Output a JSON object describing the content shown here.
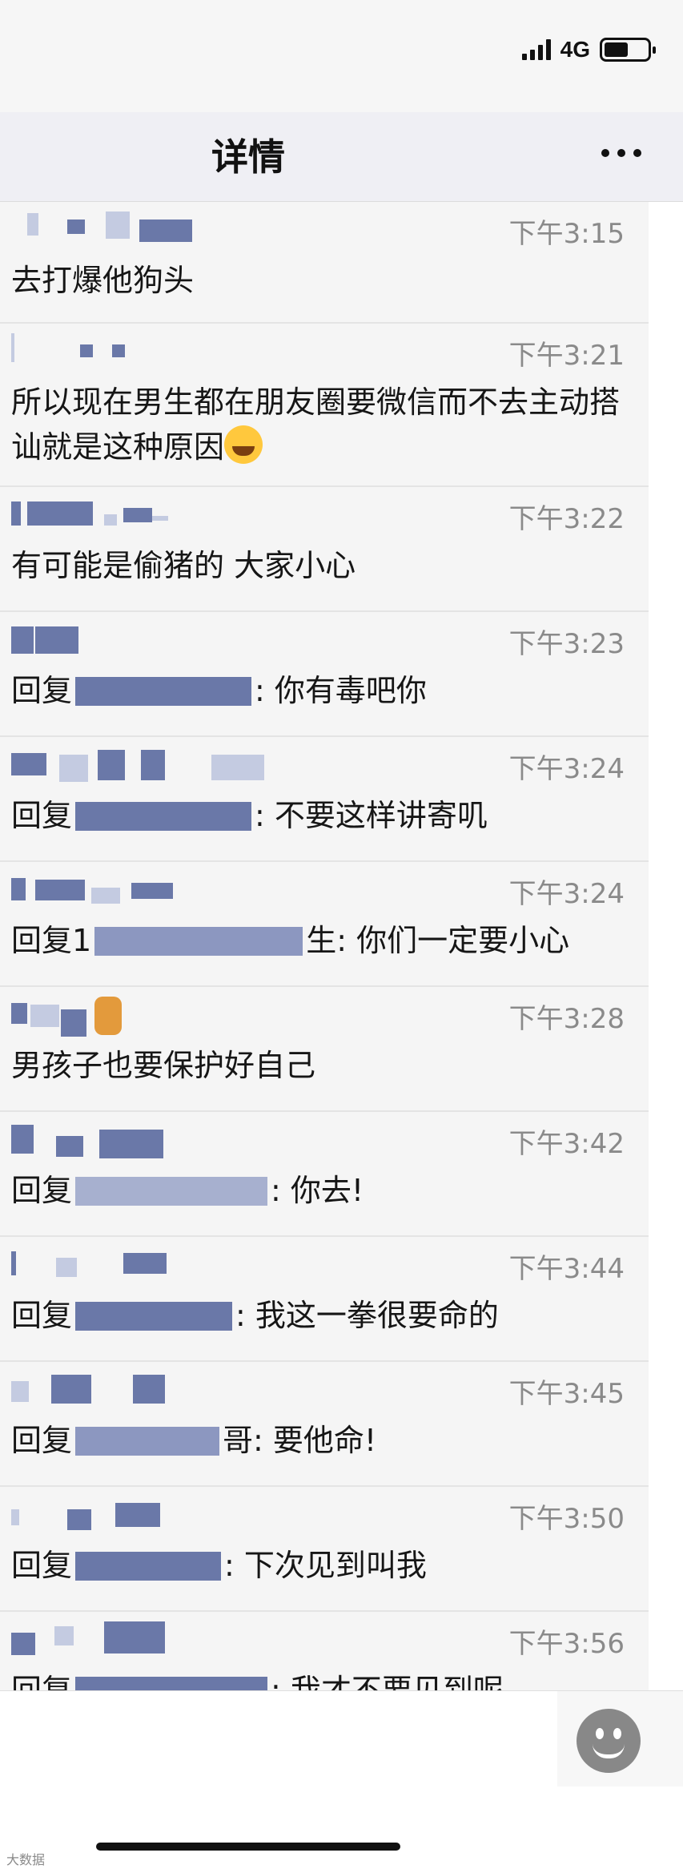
{
  "status_bar": {
    "network": "4G",
    "signal_bars": 4,
    "battery_level": 0.55
  },
  "nav": {
    "title": "详情",
    "more_icon": "more-dots-icon"
  },
  "messages": [
    {
      "time": "下午3:15",
      "text": "去打爆他狗头"
    },
    {
      "time": "下午3:21",
      "text": "所以现在男生都在朋友圈要微信而不去主动搭讪就是这种原因",
      "emoji": "laughing-tears-emoji"
    },
    {
      "time": "下午3:22",
      "text": "有可能是偷猪的 大家小心"
    },
    {
      "time": "下午3:23",
      "text": "回复",
      "suffix": ": 你有毒吧你"
    },
    {
      "time": "下午3:24",
      "text": "回复",
      "suffix": ": 不要这样讲寄叽"
    },
    {
      "time": "下午3:24",
      "text": "回复1",
      "suffix": "生: 你们一定要小心"
    },
    {
      "time": "下午3:28",
      "text": "男孩子也要保护好自己"
    },
    {
      "time": "下午3:42",
      "text": "回复",
      "suffix": ": 你去!"
    },
    {
      "time": "下午3:44",
      "text": "回复",
      "suffix": ": 我这一拳很要命的"
    },
    {
      "time": "下午3:45",
      "text": "回复",
      "suffix": "哥: 要他命!"
    },
    {
      "time": "下午3:50",
      "text": "回复",
      "suffix": ": 下次见到叫我"
    },
    {
      "time": "下午3:56",
      "text": "回复",
      "suffix": ": 我才不要见到呢"
    }
  ],
  "input_bar": {
    "emoji_button": "smiley-face-icon"
  },
  "watermark": "大数据"
}
